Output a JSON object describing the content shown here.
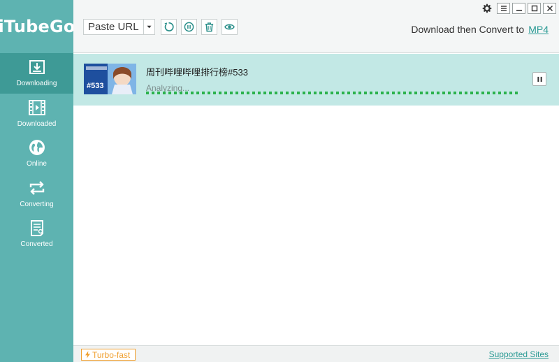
{
  "app": {
    "brand": "iTubeGo"
  },
  "sidebar": {
    "items": [
      {
        "label": "Downloading",
        "icon": "download-icon",
        "active": true
      },
      {
        "label": "Downloaded",
        "icon": "film-icon",
        "active": false
      },
      {
        "label": "Online",
        "icon": "globe-icon",
        "active": false
      },
      {
        "label": "Converting",
        "icon": "convert-icon",
        "active": false
      },
      {
        "label": "Converted",
        "icon": "document-icon",
        "active": false
      }
    ]
  },
  "toolbar": {
    "paste_url_label": "Paste URL",
    "convert_label": "Download then Convert to",
    "convert_format": "MP4"
  },
  "downloads": [
    {
      "title": "周刊哔哩哔哩排行榜#533",
      "status": "Analyzing...",
      "thumb_text": "#533"
    }
  ],
  "footer": {
    "turbo_label": "Turbo-fast",
    "supported_label": "Supported Sites"
  },
  "colors": {
    "sidebar": "#5eb3b1",
    "sidebar_active": "#3e9a96",
    "row_bg": "#c2e8e5",
    "progress": "#2bb24c",
    "accent": "#2a9a94",
    "turbo": "#f0a030"
  }
}
